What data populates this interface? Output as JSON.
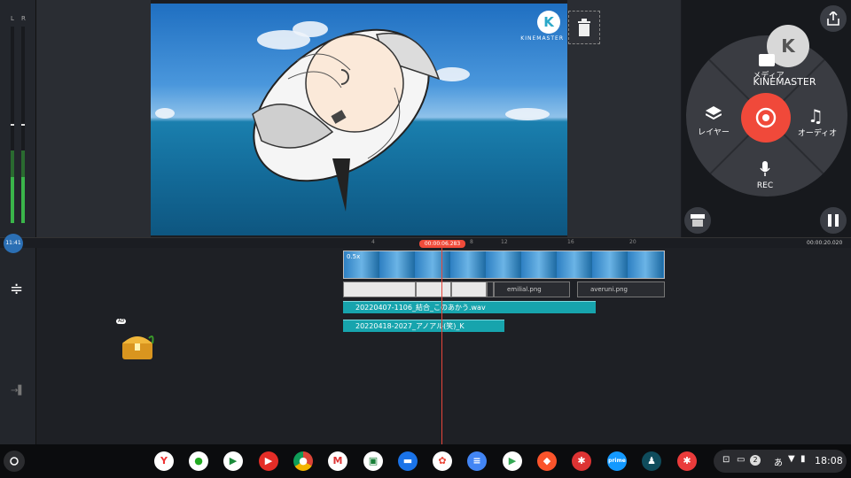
{
  "meter": {
    "left_label": "L",
    "right_label": "R"
  },
  "preview": {
    "watermark_text": "KINEMASTER",
    "watermark_icon": "K"
  },
  "wheel": {
    "logo_letter": "K",
    "logo_text": "KINEMASTER",
    "media_label": "メディア",
    "layer_label": "レイヤー",
    "audio_label": "オーディオ",
    "rec_label": "REC"
  },
  "timeline": {
    "playhead_time": "00:00:06.283",
    "end_time": "00:00:20.020",
    "badge_time": "11:41",
    "ticks": [
      "4",
      "8",
      "12",
      "16",
      "20"
    ],
    "speed_label": "0.5x",
    "overlay_clips": [
      "",
      "",
      "",
      "",
      "emilial.png",
      "averuni.png"
    ],
    "audio_clips": [
      "20220407-1106_結合_このあかう.wav",
      "20220418-2027_アノアル(笑)_K"
    ]
  },
  "ad_badge": "AD",
  "shelf": {
    "apps": [
      "yahoo",
      "camera",
      "meet",
      "youtube",
      "chrome",
      "gmail",
      "classroom",
      "files",
      "photos",
      "docs",
      "play-store",
      "brave",
      "kinemaster-alt",
      "prime-video",
      "kindle",
      "kinemaster"
    ],
    "notification_count": "2",
    "ime": "あ",
    "time": "18:08"
  },
  "colors": {
    "accent": "#f0493a",
    "audio_track": "#17a4ad",
    "playhead": "#e8463a"
  }
}
